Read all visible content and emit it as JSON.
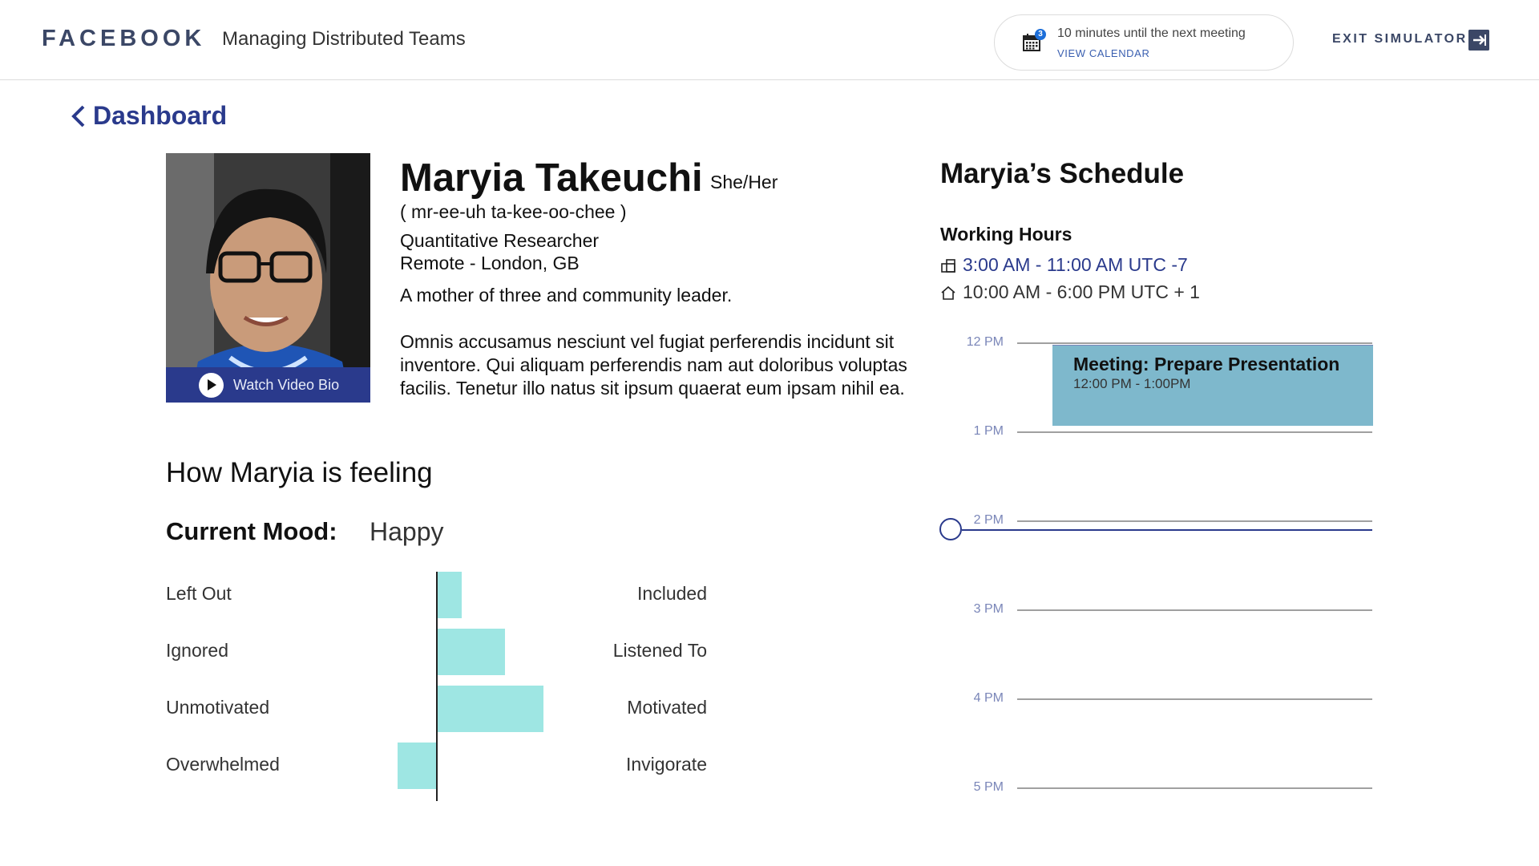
{
  "header": {
    "brand": "FACEBOOK",
    "app_title": "Managing Distributed Teams",
    "notification_count": "3",
    "meeting_notice": "10 minutes until the next meeting",
    "view_calendar": "VIEW CALENDAR",
    "exit_label": "EXIT SIMULATOR"
  },
  "nav": {
    "back_label": "Dashboard"
  },
  "profile": {
    "name": "Maryia Takeuchi",
    "pronouns": "She/Her",
    "phonetic": "( mr-ee-uh   ta-kee-oo-chee )",
    "role": "Quantitative Researcher",
    "location": "Remote - London, GB",
    "tagline": "A mother of three and community leader.",
    "bio": "Omnis accusamus nesciunt vel fugiat perferendis incidunt sit inventore. Qui aliquam perferendis nam aut doloribus voluptas facilis. Tenetur illo natus sit ipsum quaerat eum ipsam nihil ea.",
    "video_label": "Watch Video Bio"
  },
  "feeling": {
    "title": "How Maryia is feeling",
    "mood_label": "Current Mood:",
    "mood_value": "Happy",
    "scales": [
      {
        "left": "Left Out",
        "right": "Included",
        "value": 0.25
      },
      {
        "left": "Ignored",
        "right": "Listened To",
        "value": 0.7
      },
      {
        "left": "Unmotivated",
        "right": "Motivated",
        "value": 1.1
      },
      {
        "left": "Overwhelmed",
        "right": "Invigorate",
        "value": -0.4
      }
    ]
  },
  "schedule": {
    "title": "Maryia’s Schedule",
    "working_hours_title": "Working Hours",
    "office_hours": "3:00 AM - 11:00 AM UTC -7",
    "home_hours": "10:00 AM - 6:00 PM UTC + 1",
    "hours": [
      "12 PM",
      "1 PM",
      "2 PM",
      "3 PM",
      "4 PM",
      "5 PM"
    ],
    "meeting": {
      "title": "Meeting: Prepare Presentation",
      "time": "12:00 PM - 1:00PM"
    },
    "current_time_hours_after_noon": 2.1
  },
  "colors": {
    "brand_navy": "#2a3a8c",
    "mood_bar": "#9ee6e3",
    "meeting_block": "#7eb8cc"
  }
}
